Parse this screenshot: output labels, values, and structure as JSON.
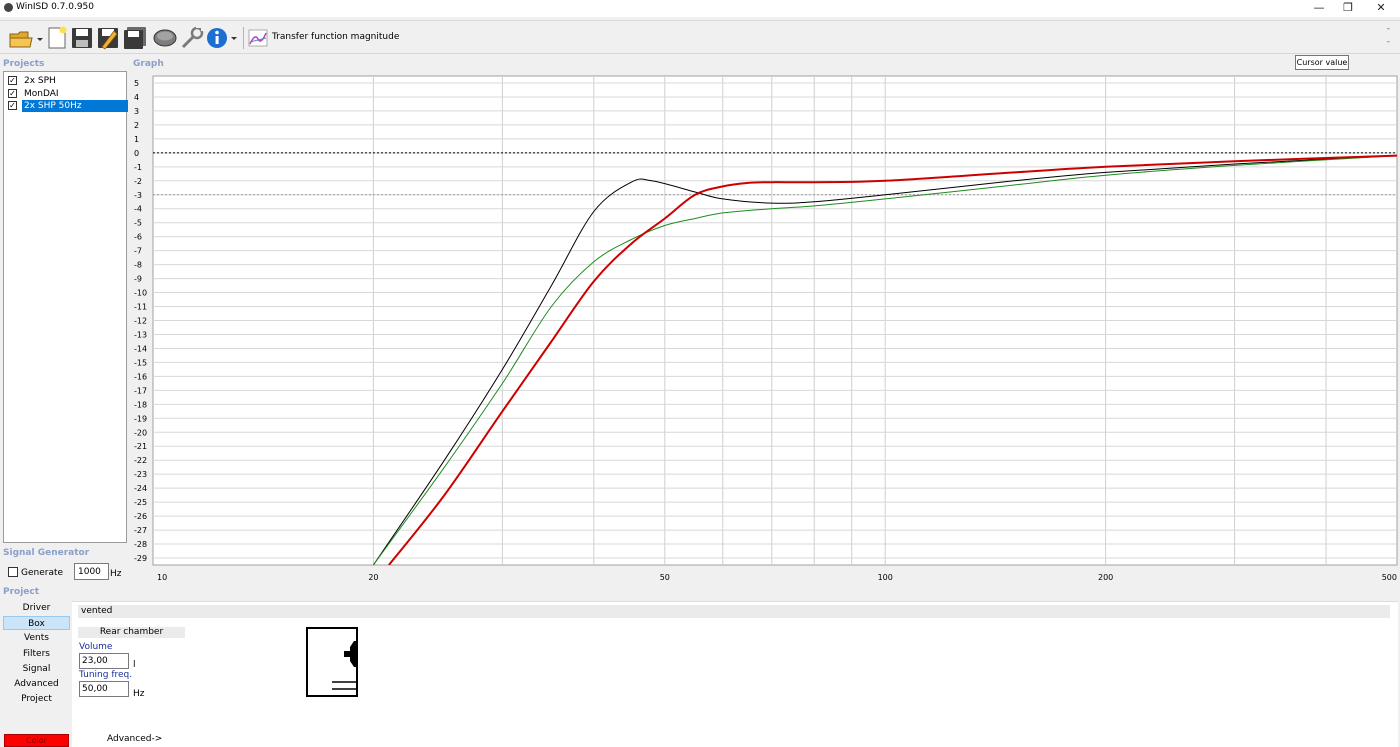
{
  "window": {
    "title": "WinISD 0.7.0.950",
    "controls": {
      "minimize": "—",
      "restore": "❐",
      "close": "✕"
    }
  },
  "toolbar": {
    "buttons": [
      "open-icon",
      "new-icon",
      "save-icon",
      "save-as-icon",
      "save-all-icon",
      "driver-icon",
      "tools-icon",
      "info-icon"
    ],
    "graph_type_label": "Transfer function magnitude",
    "scroll_up": "-",
    "scroll_down": "-"
  },
  "projects": {
    "label": "Projects",
    "items": [
      {
        "label": "2x SPH",
        "checked": true,
        "selected": false
      },
      {
        "label": "MonDAI",
        "checked": true,
        "selected": false
      },
      {
        "label": "2x SHP 50Hz",
        "checked": true,
        "selected": true
      }
    ]
  },
  "graph": {
    "label": "Graph",
    "cursor_tooltip": "Cursor value"
  },
  "chart_data": {
    "type": "line",
    "x_scale": "log",
    "xlim": [
      10,
      500
    ],
    "ylim": [
      -29.5,
      5.5
    ],
    "x_tick_labels": [
      10,
      20,
      50,
      100,
      200,
      500
    ],
    "y_tick_labels": [
      5,
      4,
      3,
      2,
      1,
      0,
      -1,
      -2,
      -3,
      -4,
      -5,
      -6,
      -7,
      -8,
      -9,
      -10,
      -11,
      -12,
      -13,
      -14,
      -15,
      -16,
      -17,
      -18,
      -19,
      -20,
      -21,
      -22,
      -23,
      -24,
      -25,
      -26,
      -27,
      -28,
      -29
    ],
    "reference_lines": [
      0,
      -3
    ],
    "grid": true,
    "series": [
      {
        "color": "#000000",
        "x": [
          20,
          25,
          30,
          35,
          40,
          45,
          48,
          55,
          60,
          70,
          80,
          100,
          150,
          200,
          300,
          500
        ],
        "y": [
          -29.5,
          -22,
          -15.5,
          -9.5,
          -4.2,
          -2.1,
          -2.0,
          -2.8,
          -3.3,
          -3.6,
          -3.5,
          -3.0,
          -2.0,
          -1.4,
          -0.8,
          -0.2
        ]
      },
      {
        "color": "#1e8c1e",
        "x": [
          20,
          25,
          30,
          35,
          40,
          45,
          50,
          55,
          60,
          70,
          80,
          100,
          150,
          200,
          300,
          500
        ],
        "y": [
          -29.5,
          -22.5,
          -16.5,
          -11,
          -7.8,
          -6.2,
          -5.2,
          -4.7,
          -4.3,
          -4.0,
          -3.8,
          -3.3,
          -2.3,
          -1.6,
          -0.9,
          -0.2
        ]
      },
      {
        "color": "#cc0000",
        "x": [
          21,
          25,
          30,
          35,
          40,
          45,
          50,
          55,
          60,
          65,
          70,
          80,
          100,
          150,
          200,
          300,
          500
        ],
        "y": [
          -29.5,
          -24.5,
          -18.5,
          -13.5,
          -9.2,
          -6.5,
          -4.7,
          -3.0,
          -2.4,
          -2.15,
          -2.1,
          -2.1,
          -2.0,
          -1.4,
          -1.0,
          -0.6,
          -0.2
        ]
      }
    ]
  },
  "signal_generator": {
    "label": "Signal Generator",
    "generate_label": "Generate",
    "generate_checked": false,
    "frequency": "1000",
    "unit": "Hz"
  },
  "project_nav": {
    "label": "Project",
    "items": [
      "Driver",
      "Box",
      "Vents",
      "Filters",
      "Signal",
      "Advanced",
      "Project"
    ],
    "selected_index": 1
  },
  "box_panel": {
    "type": "vented",
    "chamber_header": "Rear chamber",
    "volume_label": "Volume",
    "volume_value": "23,00",
    "volume_unit": "l",
    "tuning_label": "Tuning freq.",
    "tuning_value": "50,00",
    "tuning_unit": "Hz",
    "advanced_link": "Advanced->",
    "color_button": "Color",
    "color_value": "#ff0000"
  }
}
